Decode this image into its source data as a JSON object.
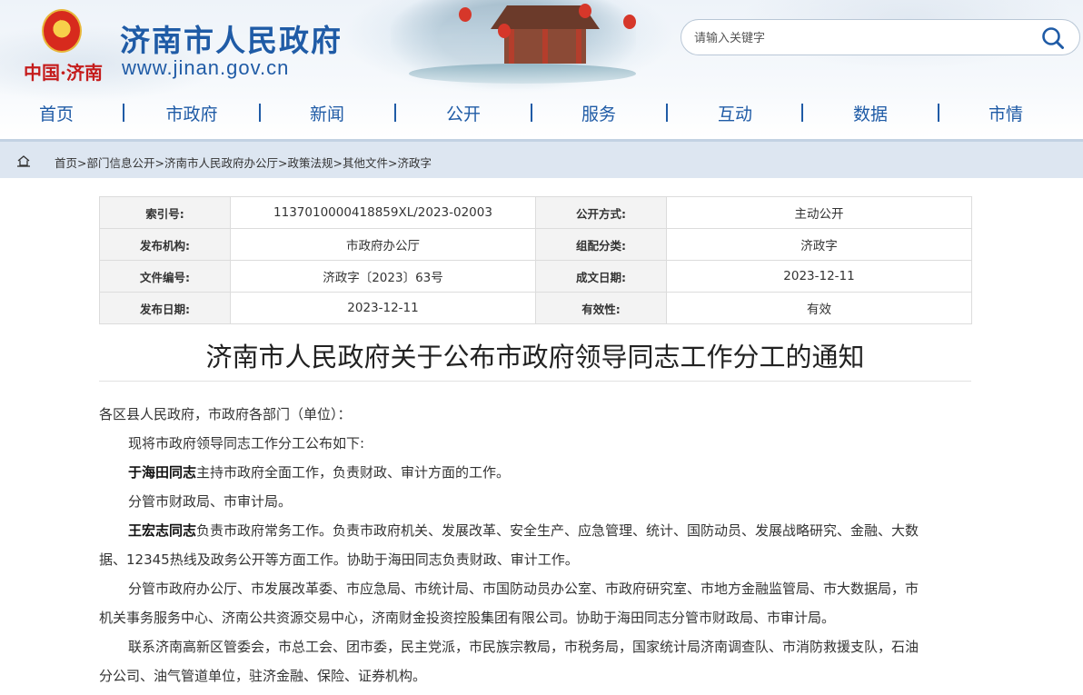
{
  "header": {
    "logo_text": "中国·济南",
    "site_title": "济南市人民政府",
    "site_url": "www.jinan.gov.cn",
    "emblem_icon": "national-emblem-icon",
    "brand_color": "#1f5ba6",
    "logo_color": "#c51c1c"
  },
  "search": {
    "placeholder": "请输入关键字",
    "icon": "search-icon"
  },
  "nav": {
    "items": [
      {
        "label": "首页"
      },
      {
        "label": "市政府"
      },
      {
        "label": "新闻"
      },
      {
        "label": "公开"
      },
      {
        "label": "服务"
      },
      {
        "label": "互动"
      },
      {
        "label": "数据"
      },
      {
        "label": "市情"
      }
    ]
  },
  "breadcrumb": {
    "home_icon": "home-icon",
    "items": [
      "首页",
      "部门信息公开",
      "济南市人民政府办公厅",
      "政策法规",
      "其他文件",
      "济政字"
    ],
    "separator": ">"
  },
  "meta": {
    "rows": [
      {
        "label1": "索引号:",
        "value1": "1137010000418859XL/2023-02003",
        "label2": "公开方式:",
        "value2": "主动公开"
      },
      {
        "label1": "发布机构:",
        "value1": "市政府办公厅",
        "label2": "组配分类:",
        "value2": "济政字"
      },
      {
        "label1": "文件编号:",
        "value1": "济政字〔2023〕63号",
        "label2": "成文日期:",
        "value2": "2023-12-11"
      },
      {
        "label1": "发布日期:",
        "value1": "2023-12-11",
        "label2": "有效性:",
        "value2": "有效"
      }
    ]
  },
  "article": {
    "title": "济南市人民政府关于公布市政府领导同志工作分工的通知",
    "salutation": "各区县人民政府，市政府各部门（单位）：",
    "intro": "现将市政府领导同志工作分工公布如下:",
    "p1_name": "于海田同志",
    "p1_text": "主持市政府全面工作，负责财政、审计方面的工作。",
    "p2": "分管市财政局、市审计局。",
    "p3_name": "王宏志同志",
    "p3_line1": "负责市政府常务工作。负责市政府机关、发展改革、安全生产、应急管理、统计、国防动员、发展战略研究、金融、大数",
    "p3_line2": "据、12345热线及政务公开等方面工作。协助于海田同志负责财政、审计工作。",
    "p4_line1": "分管市政府办公厅、市发展改革委、市应急局、市统计局、市国防动员办公室、市政府研究室、市地方金融监管局、市大数据局，市",
    "p4_line2": "机关事务服务中心、济南公共资源交易中心，济南财金投资控股集团有限公司。协助于海田同志分管市财政局、市审计局。",
    "p5_line1": "联系济南高新区管委会，市总工会、团市委，民主党派，市民族宗教局，市税务局，国家统计局济南调查队、市消防救援支队，石油",
    "p5_line2": "分公司、油气管道单位，驻济金融、保险、证券机构。"
  }
}
